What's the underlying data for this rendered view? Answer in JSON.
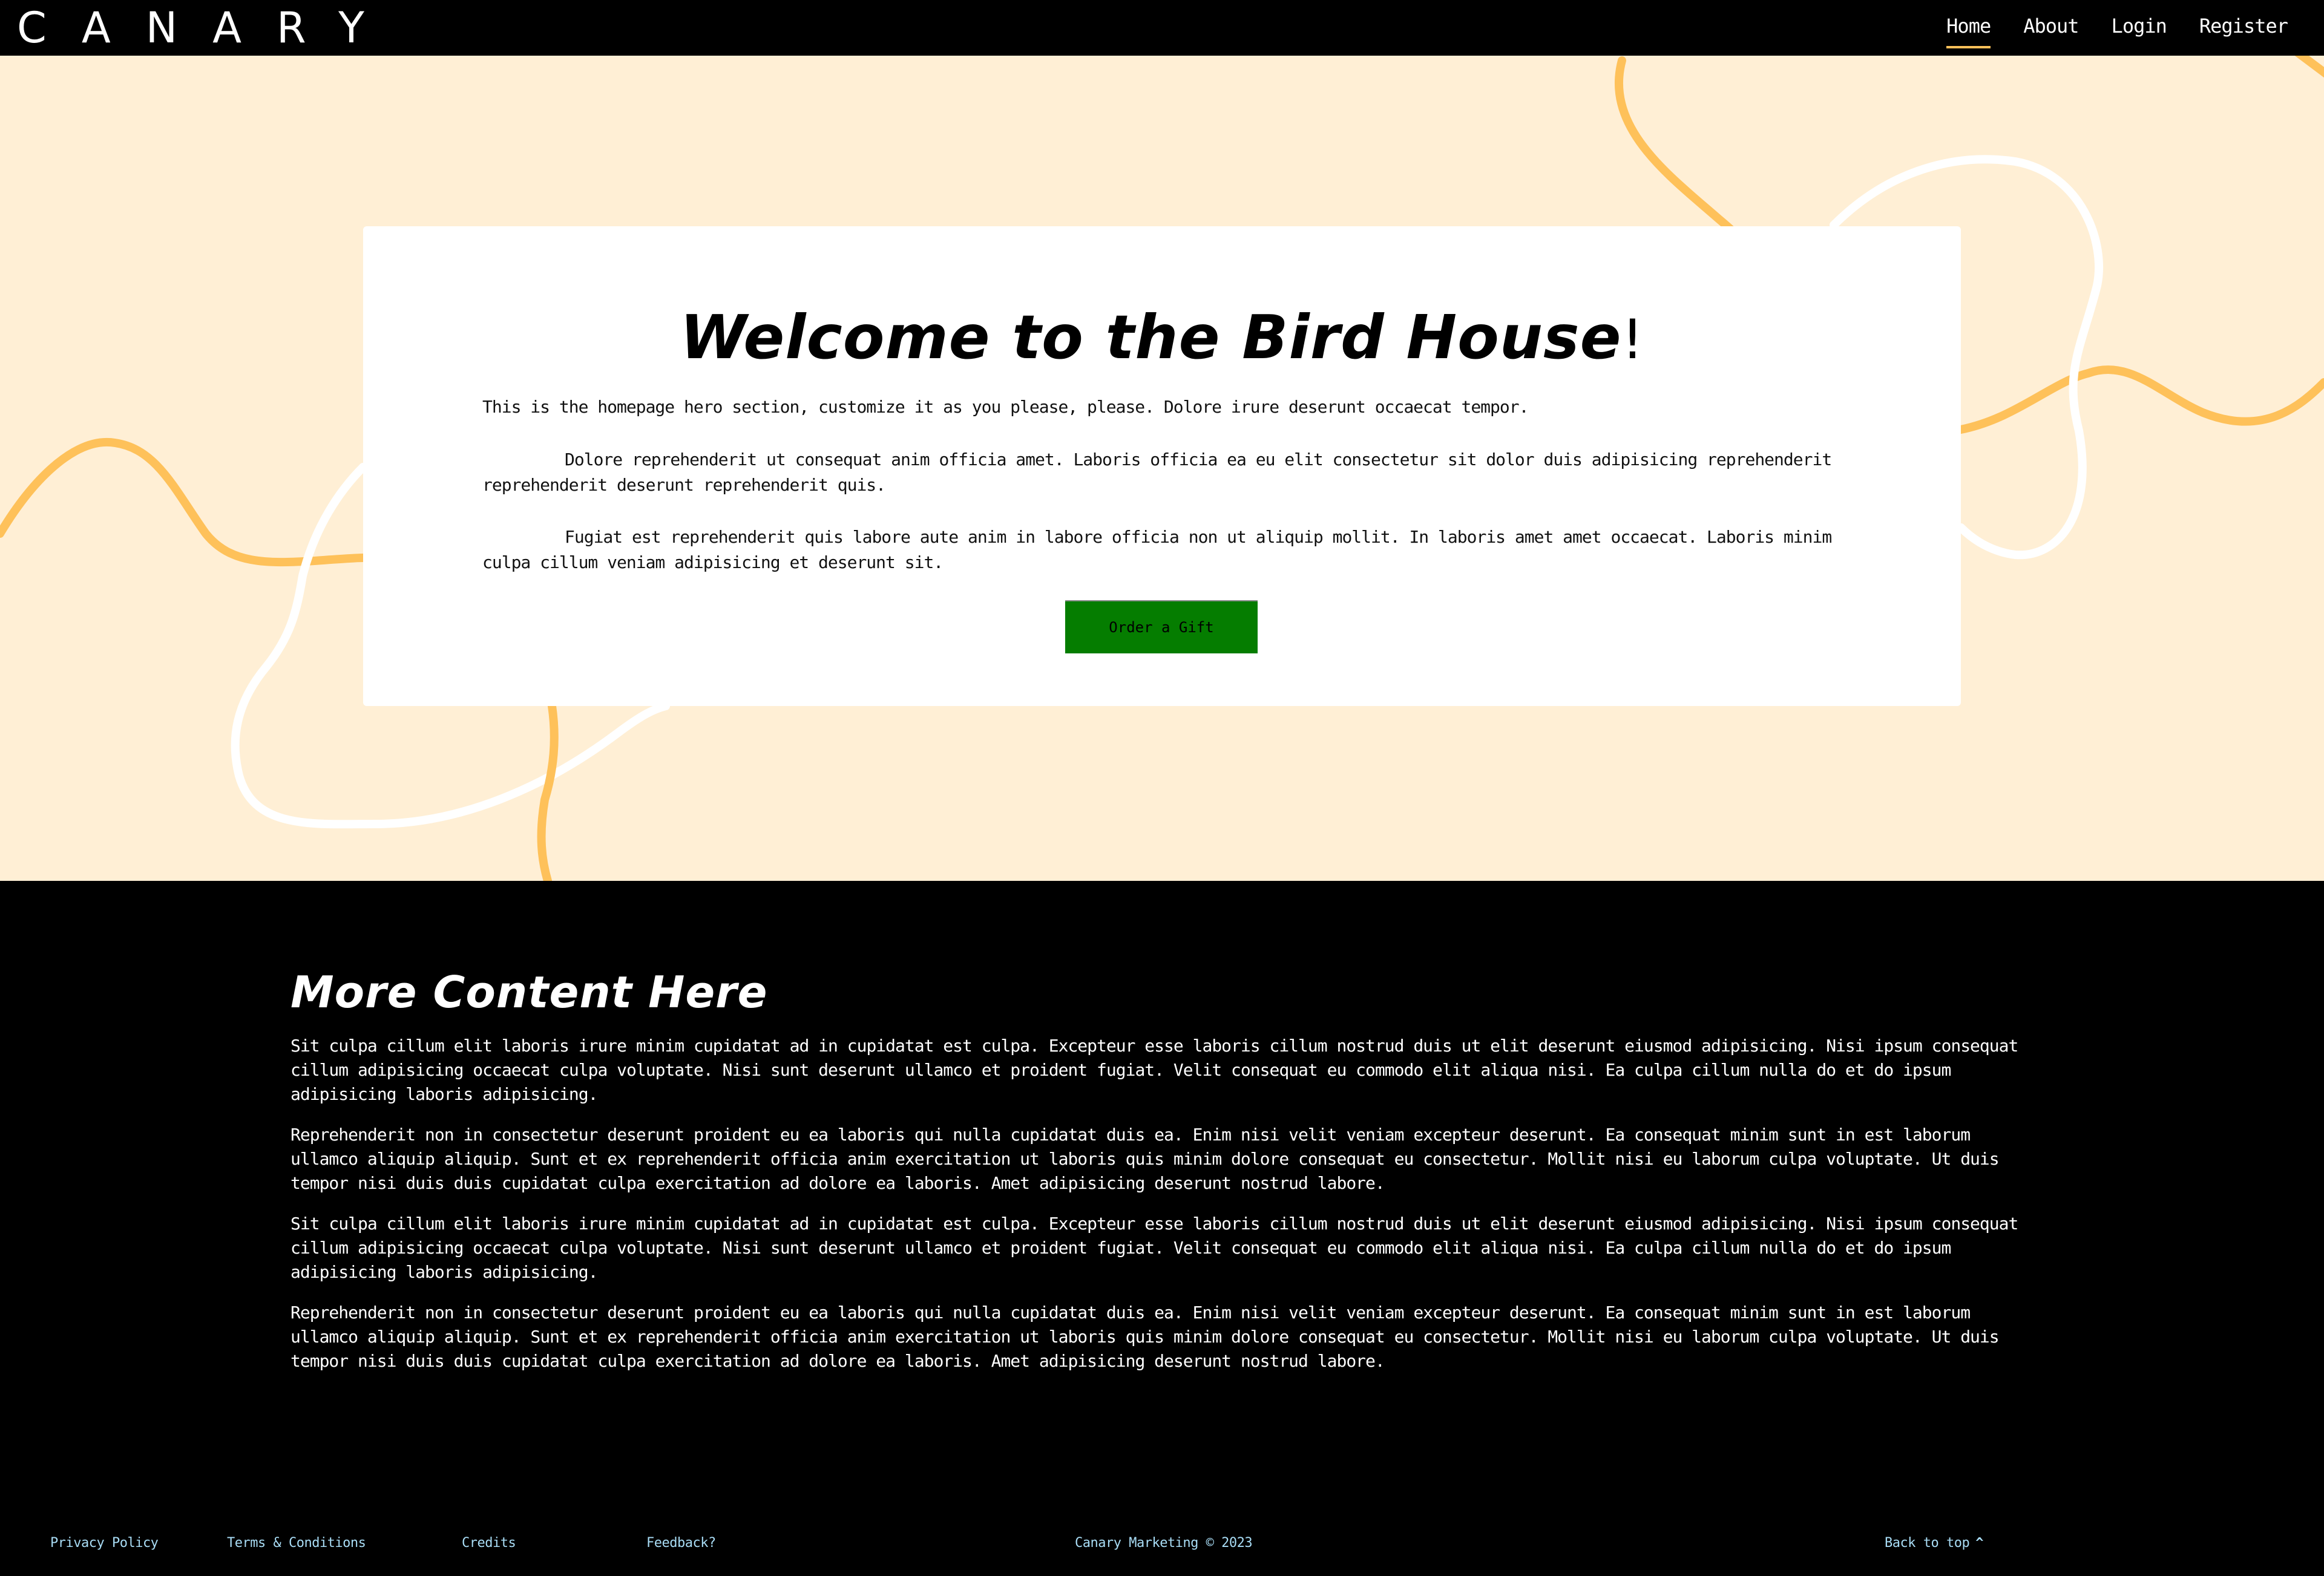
{
  "brand": {
    "logo": "CANARY"
  },
  "nav": {
    "items": [
      {
        "label": "Home",
        "active": true
      },
      {
        "label": "About",
        "active": false
      },
      {
        "label": "Login",
        "active": false
      },
      {
        "label": "Register",
        "active": false
      }
    ]
  },
  "hero": {
    "title": "Welcome to the Bird House",
    "title_suffix": "!",
    "paragraphs": [
      "This is the homepage hero section, customize it as you please, please. Dolore irure deserunt occaecat tempor.",
      "Dolore reprehenderit ut consequat anim officia amet. Laboris officia ea eu elit consectetur sit dolor duis adipisicing reprehenderit reprehenderit deserunt reprehenderit quis.",
      "Fugiat est reprehenderit quis labore aute anim in labore officia non ut aliquip mollit. In laboris amet amet occaecat. Laboris minim culpa cillum veniam adipisicing et deserunt sit."
    ],
    "cta_label": "Order a Gift"
  },
  "more": {
    "title": "More Content Here",
    "paragraphs": [
      "Sit culpa cillum elit laboris irure minim cupidatat ad in cupidatat est culpa. Excepteur esse laboris cillum nostrud duis ut elit deserunt eiusmod adipisicing. Nisi ipsum consequat cillum adipisicing occaecat culpa voluptate. Nisi sunt deserunt ullamco et proident fugiat. Velit consequat eu commodo elit aliqua nisi. Ea culpa cillum nulla do et do ipsum adipisicing laboris adipisicing.",
      "Reprehenderit non in consectetur deserunt proident eu ea laboris qui nulla cupidatat duis ea. Enim nisi velit veniam excepteur deserunt. Ea consequat minim sunt in est laborum ullamco aliquip aliquip. Sunt et ex reprehenderit officia anim exercitation ut laboris quis minim dolore consequat eu consectetur. Mollit nisi eu laborum culpa voluptate. Ut duis tempor nisi duis duis cupidatat culpa exercitation ad dolore ea laboris. Amet adipisicing deserunt nostrud labore.",
      "Sit culpa cillum elit laboris irure minim cupidatat ad in cupidatat est culpa. Excepteur esse laboris cillum nostrud duis ut elit deserunt eiusmod adipisicing. Nisi ipsum consequat cillum adipisicing occaecat culpa voluptate. Nisi sunt deserunt ullamco et proident fugiat. Velit consequat eu commodo elit aliqua nisi. Ea culpa cillum nulla do et do ipsum adipisicing laboris adipisicing.",
      "Reprehenderit non in consectetur deserunt proident eu ea laboris qui nulla cupidatat duis ea. Enim nisi velit veniam excepteur deserunt. Ea consequat minim sunt in est laborum ullamco aliquip aliquip. Sunt et ex reprehenderit officia anim exercitation ut laboris quis minim dolore consequat eu consectetur. Mollit nisi eu laborum culpa voluptate. Ut duis tempor nisi duis duis cupidatat culpa exercitation ad dolore ea laboris. Amet adipisicing deserunt nostrud labore."
    ]
  },
  "footer": {
    "privacy": "Privacy Policy",
    "terms": "Terms & Conditions",
    "credits": "Credits",
    "feedback": "Feedback?",
    "copyright": "Canary Marketing © 2023",
    "back_to_top": "Back to top",
    "back_to_top_icon": "chevron-up-icon"
  },
  "colors": {
    "nav_bg": "#000000",
    "hero_bg": "#ffefd5",
    "accent_yellow": "#fec15a",
    "cta_green": "#057d00",
    "footer_link": "#a9ddf6"
  }
}
